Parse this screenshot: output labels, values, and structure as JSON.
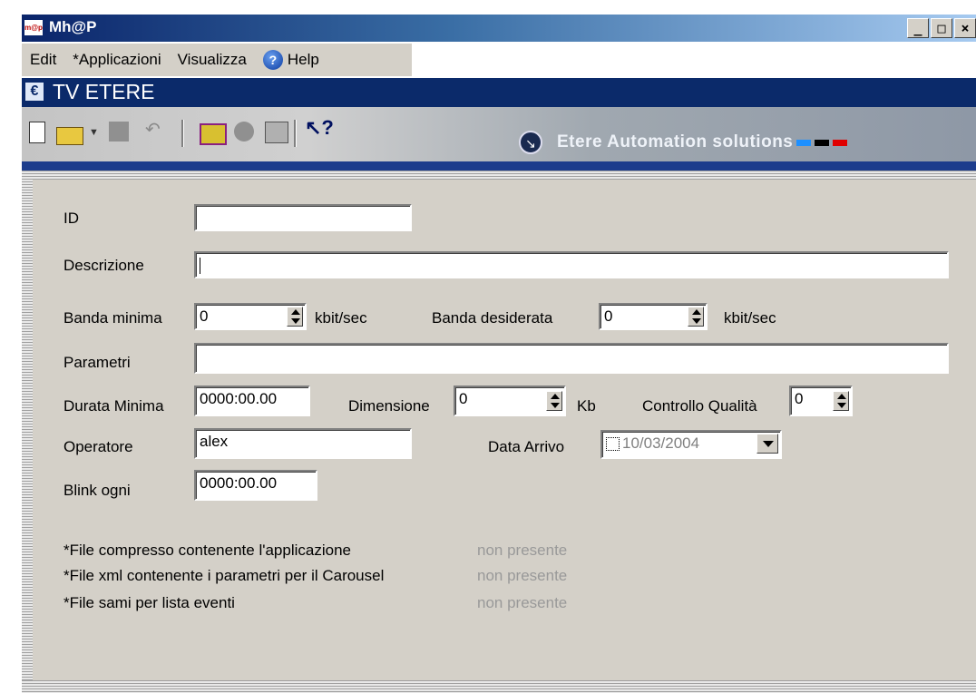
{
  "window": {
    "title": "Mh@P",
    "icon": "mhap-app-icon",
    "buttons": [
      "_",
      "□",
      "×"
    ]
  },
  "menu": {
    "items": [
      "Edit",
      "*Applicazioni",
      "Visualizza"
    ],
    "help": "Help"
  },
  "header": {
    "app_name": "TV ETERE"
  },
  "toolbar": {
    "icons": [
      "new-document-icon",
      "open-folder-icon",
      "save-icon",
      "undo-icon",
      "calendar-grid-icon",
      "globe-icon",
      "computer-icon",
      "context-help-icon"
    ],
    "brand": "Etere Automation solutions",
    "brand_colors": [
      "#1e90ff",
      "#000000",
      "#e00000"
    ]
  },
  "form": {
    "id": {
      "label": "ID",
      "value": ""
    },
    "descrizione": {
      "label": "Descrizione",
      "value": ""
    },
    "banda_minima": {
      "label": "Banda minima",
      "value": "0",
      "unit": "kbit/sec"
    },
    "banda_desiderata": {
      "label": "Banda desiderata",
      "value": "0",
      "unit": "kbit/sec"
    },
    "parametri": {
      "label": "Parametri",
      "value": ""
    },
    "durata_minima": {
      "label": "Durata Minima",
      "value": "0000:00.00"
    },
    "dimensione": {
      "label": "Dimensione",
      "value": "0",
      "unit": "Kb"
    },
    "controllo_qualita": {
      "label": "Controllo Qualità",
      "value": "0"
    },
    "operatore": {
      "label": "Operatore",
      "value": "alex"
    },
    "data_arrivo": {
      "label": "Data Arrivo",
      "value": "10/03/2004",
      "checked": false
    },
    "blink_ogni": {
      "label": "Blink ogni",
      "value": "0000:00.00"
    }
  },
  "files": [
    {
      "label": "*File compresso contenente l'applicazione",
      "status": "non presente"
    },
    {
      "label": "*File xml contenente i parametri per il Carousel",
      "status": "non presente"
    },
    {
      "label": "*File sami per lista eventi",
      "status": "non presente"
    }
  ]
}
